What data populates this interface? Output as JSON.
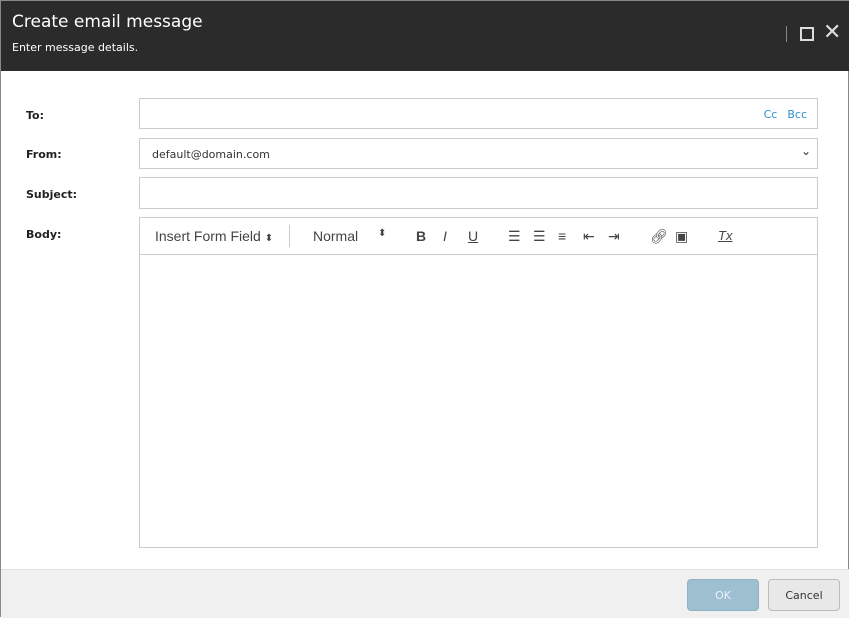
{
  "header": {
    "title": "Create email message",
    "subtitle": "Enter message details."
  },
  "form": {
    "to_label": "To:",
    "to_value": "",
    "cc": "Cc",
    "bcc": "Bcc",
    "from_label": "From:",
    "from_value": "default@domain.com",
    "subject_label": "Subject:",
    "subject_value": "",
    "body_label": "Body:"
  },
  "toolbar": {
    "insert_field": "Insert Form Field",
    "style": "Normal",
    "bold": "B",
    "italic": "I",
    "underline": "U",
    "clear": "Tx"
  },
  "footer": {
    "ok": "OK",
    "cancel": "Cancel"
  }
}
